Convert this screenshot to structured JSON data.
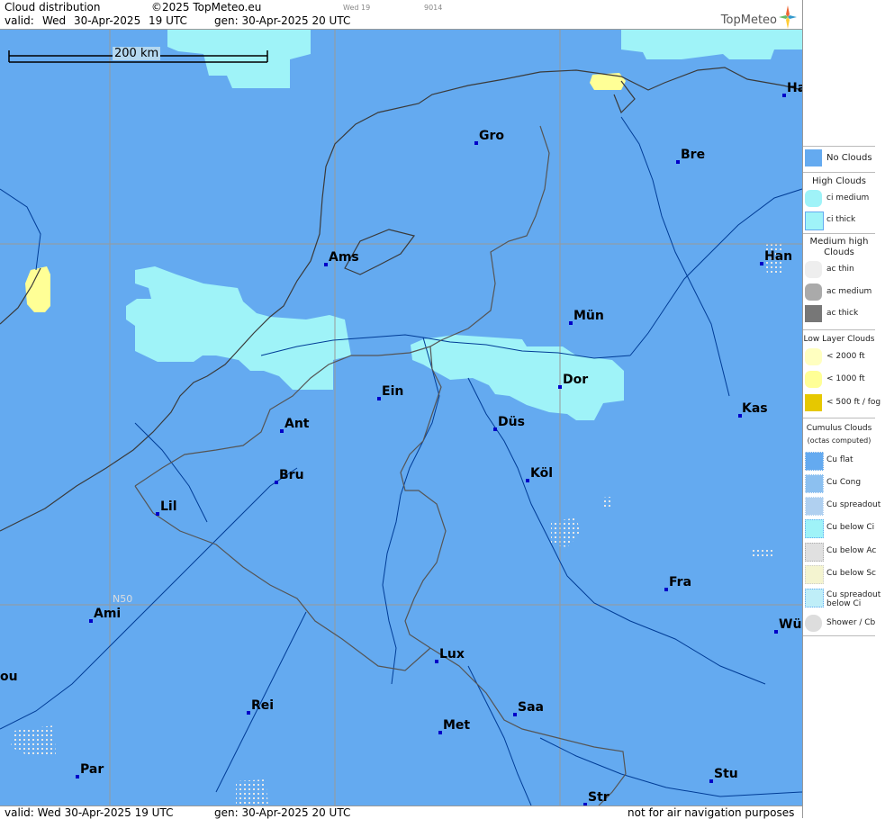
{
  "header": {
    "title": "Cloud distribution",
    "copyright": "©2025 TopMeteo.eu",
    "valid_label": "valid:",
    "valid_day": "Wed",
    "valid_date": "30-Apr-2025",
    "valid_time": "19 UTC",
    "gen": "gen: 30-Apr-2025 20 UTC",
    "small_day": "Wed 19",
    "small_code": "9014",
    "logo": "TopMeteo",
    "logo_icon": "compass-star-icon"
  },
  "footer": {
    "valid": "valid:  Wed  30-Apr-2025  19 UTC",
    "gen": "gen: 30-Apr-2025 20 UTC",
    "notice": "not for air navigation purposes"
  },
  "map": {
    "scale_label": "200 km",
    "lat_label": "N50",
    "colors": {
      "sea_land": "#64aaf0",
      "ci": "#9ff3f8",
      "low": "#ffff96",
      "coast": "#4a4a4a",
      "river": "#003c96",
      "border": "#555555",
      "grid": "#999999"
    },
    "cities": [
      {
        "name": "Gro"
      },
      {
        "name": "Bre"
      },
      {
        "name": "Ha"
      },
      {
        "name": "Ams"
      },
      {
        "name": "Han"
      },
      {
        "name": "Mün"
      },
      {
        "name": "Dor"
      },
      {
        "name": "Ein"
      },
      {
        "name": "Düs"
      },
      {
        "name": "Ant"
      },
      {
        "name": "Kas"
      },
      {
        "name": "Bru"
      },
      {
        "name": "Köl"
      },
      {
        "name": "Lil"
      },
      {
        "name": "Fra"
      },
      {
        "name": "Ami"
      },
      {
        "name": "Wü"
      },
      {
        "name": "Lux"
      },
      {
        "name": "ou"
      },
      {
        "name": "Rei"
      },
      {
        "name": "Saa"
      },
      {
        "name": "Met"
      },
      {
        "name": "Par"
      },
      {
        "name": "Stu"
      },
      {
        "name": "Str"
      }
    ]
  },
  "legend": {
    "no_clouds": "No Clouds",
    "high_head": "High Clouds",
    "ci_medium": "ci medium",
    "ci_thick": "ci thick",
    "medium_head": "Medium high Clouds",
    "ac_thin": "ac thin",
    "ac_medium": "ac medium",
    "ac_thick": "ac thick",
    "low_head": "Low Layer Clouds",
    "low_2000": "< 2000 ft",
    "low_1000": "< 1000 ft",
    "low_500": "< 500 ft / fog",
    "cu_head": "Cumulus Clouds",
    "cu_sub": "(octas computed)",
    "cu_flat": "Cu flat",
    "cu_cong": "Cu Cong",
    "cu_spread": "Cu spreadout",
    "cu_below_ci": "Cu below Ci",
    "cu_below_ac": "Cu below Ac",
    "cu_below_sc": "Cu below Sc",
    "cu_spread_ci_1": "Cu spreadout",
    "cu_spread_ci_2": "below Ci",
    "shower": "Shower / Cb"
  }
}
